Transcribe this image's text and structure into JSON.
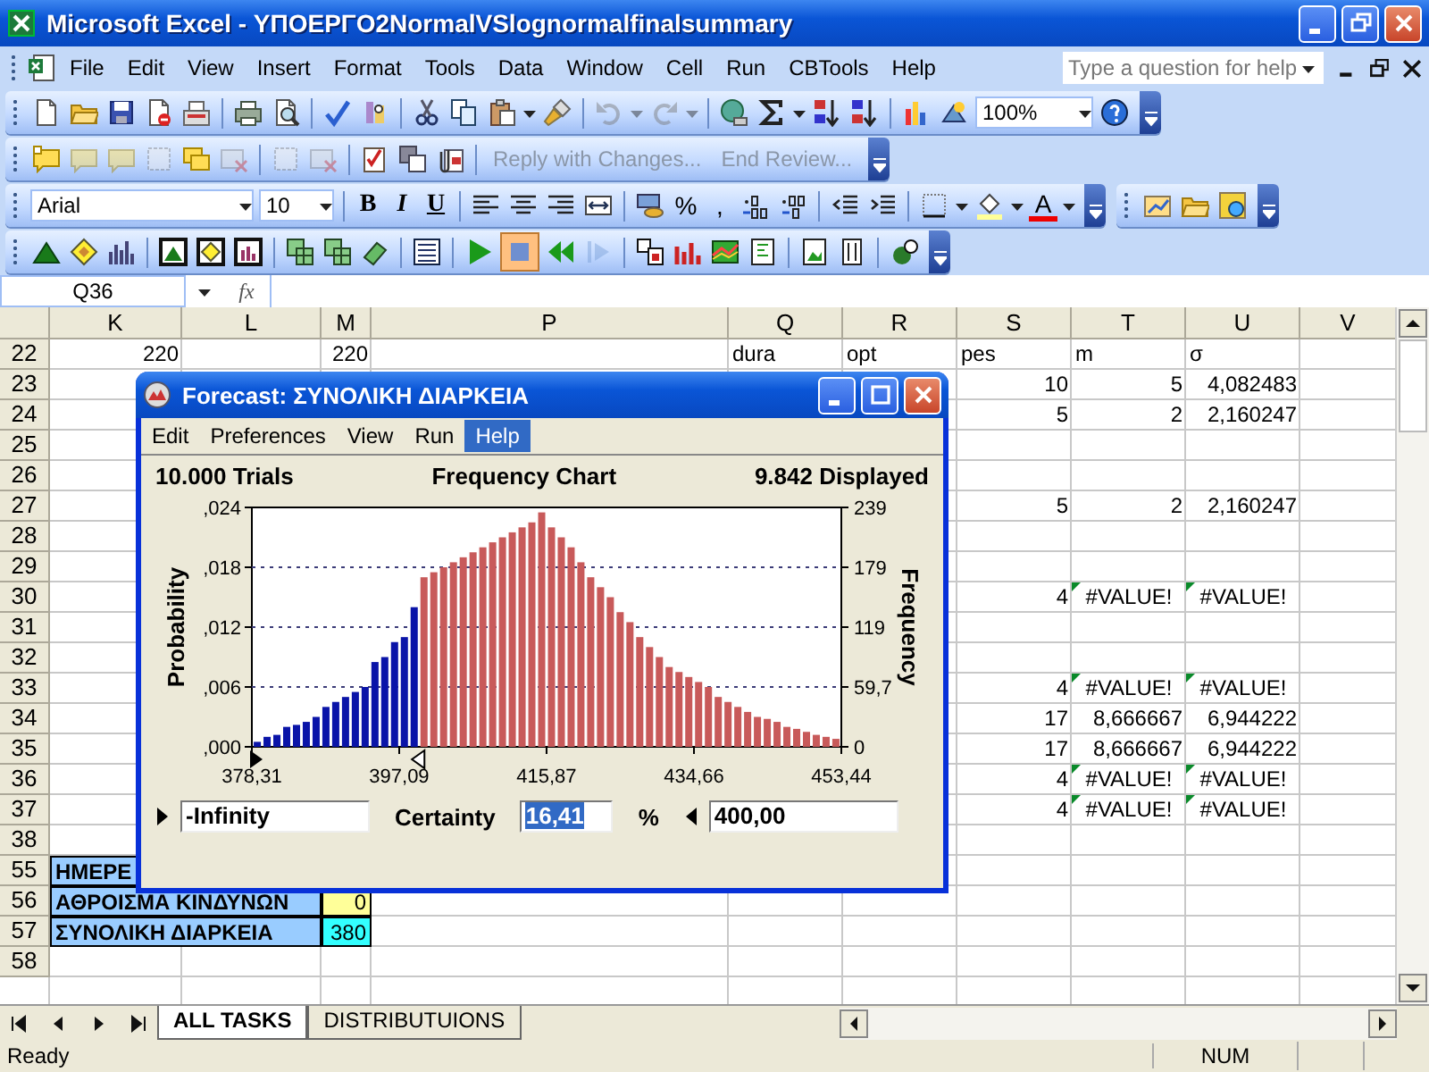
{
  "window": {
    "title": "Microsoft Excel - ΥΠΟΕΡΓΟ2NormalVSlognormalfinalsummary"
  },
  "menu": [
    "File",
    "Edit",
    "View",
    "Insert",
    "Format",
    "Tools",
    "Data",
    "Window",
    "Cell",
    "Run",
    "CBTools",
    "Help"
  ],
  "help_box": {
    "placeholder": "Type a question for help"
  },
  "standard_toolbar": {
    "zoom": "100%"
  },
  "reviewing_toolbar": {
    "buttons": [
      {
        "label": "Reply with Changes...",
        "disabled": true
      },
      {
        "label": "End Review...",
        "disabled": true
      }
    ]
  },
  "formatting_toolbar": {
    "font": "Arial",
    "size": "10",
    "style_buttons": [
      "B",
      "I",
      "U"
    ],
    "percent": "%",
    "comma": ",",
    "font_color": "A"
  },
  "crystal_ball_toolbar": {
    "stop_pressed": true
  },
  "formula_bar": {
    "name_box": "Q36",
    "fx": "fx"
  },
  "sheet": {
    "columns": [
      "K",
      "L",
      "M",
      "P",
      "Q",
      "R",
      "S",
      "T",
      "U",
      "V"
    ],
    "rows": [
      {
        "row": "22",
        "cells": {
          "K": {
            "text": "220",
            "kind": "number"
          },
          "M": {
            "text": "220",
            "kind": "number"
          },
          "Q": {
            "text": "dura",
            "kind": "text"
          },
          "R": {
            "text": "opt",
            "kind": "text"
          },
          "S": {
            "text": "pes",
            "kind": "text"
          },
          "T": {
            "text": "m",
            "kind": "text"
          },
          "U": {
            "text": "σ",
            "kind": "text"
          }
        }
      },
      {
        "row": "23",
        "cells": {
          "S": {
            "text": "10",
            "kind": "number"
          },
          "T": {
            "text": "5",
            "kind": "number"
          },
          "U": {
            "text": "4,082483",
            "kind": "number"
          }
        }
      },
      {
        "row": "24",
        "cells": {
          "S": {
            "text": "5",
            "kind": "number"
          },
          "T": {
            "text": "2",
            "kind": "number"
          },
          "U": {
            "text": "2,160247",
            "kind": "number"
          }
        }
      },
      {
        "row": "25"
      },
      {
        "row": "26"
      },
      {
        "row": "27",
        "cells": {
          "S": {
            "text": "5",
            "kind": "number"
          },
          "T": {
            "text": "2",
            "kind": "number"
          },
          "U": {
            "text": "2,160247",
            "kind": "number"
          }
        }
      },
      {
        "row": "28"
      },
      {
        "row": "29"
      },
      {
        "row": "30",
        "cells": {
          "S": {
            "text": "4",
            "kind": "number"
          },
          "T": {
            "text": "#VALUE!",
            "kind": "error",
            "error_flag": true
          },
          "U": {
            "text": "#VALUE!",
            "kind": "error",
            "error_flag": true
          }
        }
      },
      {
        "row": "31"
      },
      {
        "row": "32"
      },
      {
        "row": "33",
        "cells": {
          "S": {
            "text": "4",
            "kind": "number"
          },
          "T": {
            "text": "#VALUE!",
            "kind": "error",
            "error_flag": true
          },
          "U": {
            "text": "#VALUE!",
            "kind": "error",
            "error_flag": true
          }
        }
      },
      {
        "row": "34",
        "cells": {
          "S": {
            "text": "17",
            "kind": "number"
          },
          "T": {
            "text": "8,666667",
            "kind": "number"
          },
          "U": {
            "text": "6,944222",
            "kind": "number"
          }
        }
      },
      {
        "row": "35",
        "cells": {
          "S": {
            "text": "17",
            "kind": "number"
          },
          "T": {
            "text": "8,666667",
            "kind": "number"
          },
          "U": {
            "text": "6,944222",
            "kind": "number"
          }
        }
      },
      {
        "row": "36",
        "cells": {
          "S": {
            "text": "4",
            "kind": "number"
          },
          "T": {
            "text": "#VALUE!",
            "kind": "error",
            "error_flag": true
          },
          "U": {
            "text": "#VALUE!",
            "kind": "error",
            "error_flag": true
          }
        }
      },
      {
        "row": "37",
        "cells": {
          "S": {
            "text": "4",
            "kind": "number"
          },
          "T": {
            "text": "#VALUE!",
            "kind": "error",
            "error_flag": true
          },
          "U": {
            "text": "#VALUE!",
            "kind": "error",
            "error_flag": true
          }
        }
      },
      {
        "row": "38"
      },
      {
        "row": "55",
        "cells": {
          "K": {
            "text": "ΗΜΕΡΕ",
            "kind": "text",
            "bold": true,
            "merged": true,
            "color": "#99ccff"
          }
        }
      },
      {
        "row": "56",
        "cells": {
          "K": {
            "text": "ΑΘΡΟΙΣΜΑ ΚΙΝΔΥΝΩΝ",
            "kind": "text",
            "bold": true,
            "merged": true,
            "color": "#99ccff"
          },
          "M": {
            "text": "0",
            "kind": "number",
            "color": "#ffff99"
          }
        }
      },
      {
        "row": "57",
        "cells": {
          "K": {
            "text": "ΣΥΝΟΛΙΚΗ ΔΙΑΡΚΕΙΑ",
            "kind": "text",
            "bold": true,
            "merged": true,
            "color": "#99ccff"
          },
          "M": {
            "text": "380",
            "kind": "number",
            "color": "#33ffff"
          }
        }
      },
      {
        "row": "58"
      }
    ]
  },
  "forecast_window": {
    "title": "Forecast: ΣΥΝΟΛΙΚΗ ΔΙΑΡΚΕΙΑ",
    "menu": [
      {
        "label": "Edit",
        "selected": false
      },
      {
        "label": "Preferences",
        "selected": false
      },
      {
        "label": "View",
        "selected": false
      },
      {
        "label": "Run",
        "selected": false
      },
      {
        "label": "Help",
        "selected": true
      }
    ],
    "trials": "10.000 Trials",
    "displayed": "9.842 Displayed",
    "chart_data": {
      "type": "bar",
      "title": "Frequency Chart",
      "ylabel": "Probability",
      "grid": true,
      "xlim": [
        378.31,
        453.44
      ],
      "ylim": [
        0,
        24
      ],
      "xticks": [
        {
          "value": 378.31,
          "label": "378,31"
        },
        {
          "value": 397.09,
          "label": "397,09"
        },
        {
          "value": 415.87,
          "label": "415,87"
        },
        {
          "value": 434.66,
          "label": "434,66"
        },
        {
          "value": 453.44,
          "label": "453,44"
        }
      ],
      "yticks": [
        {
          "value": 0,
          "label": ",000"
        },
        {
          "value": 6,
          "label": ",006"
        },
        {
          "value": 12,
          "label": ",012"
        },
        {
          "value": 18,
          "label": ",018"
        },
        {
          "value": 24,
          "label": ",024"
        }
      ],
      "x": [
        379,
        380.25,
        381.5,
        382.75,
        384,
        385.25,
        386.5,
        387.75,
        389,
        390.25,
        391.5,
        392.75,
        394,
        395.25,
        396.5,
        397.75,
        399,
        400.25,
        401.5,
        402.75,
        404,
        405.25,
        406.5,
        407.75,
        409,
        410.25,
        411.5,
        412.75,
        414,
        415.25,
        416.5,
        417.75,
        419,
        420.25,
        421.5,
        422.75,
        424,
        425.25,
        426.5,
        427.75,
        429,
        430.25,
        431.5,
        432.75,
        434,
        435.25,
        436.5,
        437.75,
        439,
        440.25,
        441.5,
        442.75,
        444,
        445.25,
        446.5,
        447.75,
        449,
        450.25,
        451.5,
        452.75
      ],
      "series": [
        {
          "color": "#0a14a8",
          "values": [
            0.5,
            1,
            1.2,
            2,
            2.2,
            2.5,
            3,
            4,
            4.5,
            5,
            5.5,
            6,
            8.5,
            9,
            10.5,
            11,
            14,
            null,
            null,
            null,
            null,
            null,
            null,
            null,
            null,
            null,
            null,
            null,
            null,
            null,
            null,
            null,
            null,
            null,
            null,
            null,
            null,
            null,
            null,
            null,
            null,
            null,
            null,
            null,
            null,
            null,
            null,
            null,
            null,
            null,
            null,
            null,
            null,
            null,
            null,
            null,
            null,
            null,
            null,
            null
          ]
        },
        {
          "color": "#c85a5a",
          "values": [
            null,
            null,
            null,
            null,
            null,
            null,
            null,
            null,
            null,
            null,
            null,
            null,
            null,
            null,
            null,
            null,
            null,
            17,
            17.5,
            18,
            18.5,
            19,
            19.5,
            20,
            20.5,
            21,
            21.5,
            22,
            22.5,
            23.5,
            22,
            21,
            20,
            18.5,
            17,
            16,
            15,
            13.5,
            12.5,
            11,
            10,
            9,
            8,
            7.5,
            7,
            6.5,
            6,
            5,
            4.5,
            4,
            3.5,
            3,
            2.8,
            2.5,
            2,
            1.8,
            1.5,
            1.2,
            1,
            0.8
          ]
        }
      ]
    },
    "frequency_axis": {
      "label": "Frequency",
      "ticks": [
        "239",
        "179",
        "119",
        "59,7",
        "0"
      ]
    },
    "range": {
      "lower": "-Infinity",
      "certainty_label": "Certainty",
      "certainty": "16,41",
      "certainty_selected": true,
      "percent": "%",
      "upper": "400,00"
    }
  },
  "sheet_tabs": [
    {
      "label": "ALL TASKS",
      "selected": true
    },
    {
      "label": "DISTRIBUTUIONS",
      "selected": false
    }
  ],
  "status_bar": {
    "text": "Ready",
    "indicators": [
      "NUM"
    ]
  }
}
